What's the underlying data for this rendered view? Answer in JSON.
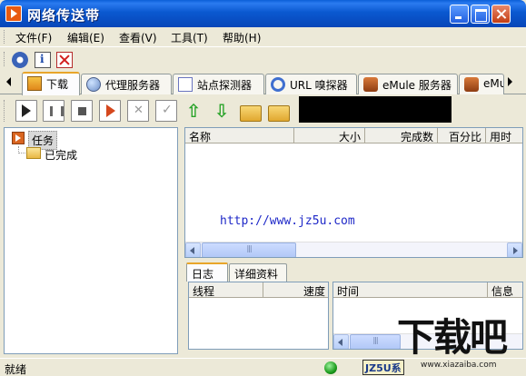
{
  "window": {
    "title": "网络传送带"
  },
  "menu": [
    {
      "label": "文件(F)"
    },
    {
      "label": "编辑(E)"
    },
    {
      "label": "查看(V)"
    },
    {
      "label": "工具(T)"
    },
    {
      "label": "帮助(H)"
    }
  ],
  "tabs": [
    {
      "label": "下载",
      "icon": "download-icon",
      "active": true
    },
    {
      "label": "代理服务器",
      "icon": "proxy-server-icon"
    },
    {
      "label": "站点探测器",
      "icon": "site-probe-icon"
    },
    {
      "label": "URL 嗅探器",
      "icon": "url-sniffer-icon"
    },
    {
      "label": "eMule 服务器",
      "icon": "emule-icon"
    },
    {
      "label": "eMul",
      "icon": "emule-icon"
    }
  ],
  "tree": {
    "root": "任务",
    "child": "已完成"
  },
  "list_columns": [
    "名称",
    "大小",
    "完成数",
    "百分比",
    "用时"
  ],
  "watermark": "http://www.jz5u.com",
  "bottom_tabs": [
    "日志",
    "详细资料"
  ],
  "log_left_columns": [
    "线程",
    "速度"
  ],
  "log_right_columns": [
    "时间",
    "信息"
  ],
  "status": {
    "text": "就绪",
    "badge": "JZ5U系",
    "led_color": "#1c9b1c"
  },
  "brand": {
    "main": "下载吧",
    "sub": "www.xiazaiba.com"
  }
}
